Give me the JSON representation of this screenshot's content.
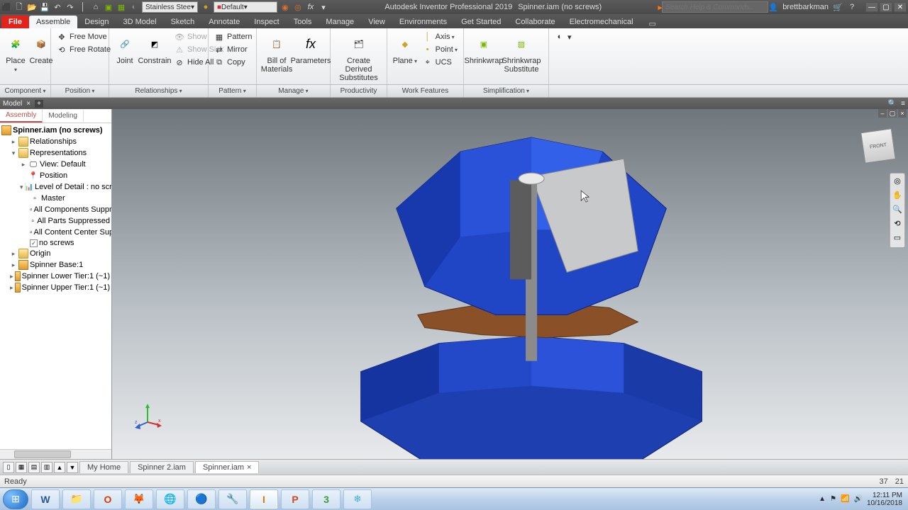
{
  "title": {
    "app": "Autodesk Inventor Professional 2019",
    "doc": "Spinner.iam (no screws)"
  },
  "search_placeholder": "Search Help & Commands..",
  "user": "brettbarkman",
  "material": "Stainless Stee",
  "appearance": "Default",
  "ribbon_tabs": [
    "File",
    "Assemble",
    "Design",
    "3D Model",
    "Sketch",
    "Annotate",
    "Inspect",
    "Tools",
    "Manage",
    "View",
    "Environments",
    "Get Started",
    "Collaborate",
    "Electromechanical"
  ],
  "ribbon": {
    "place": "Place",
    "create": "Create",
    "free_move": "Free Move",
    "free_rotate": "Free Rotate",
    "joint": "Joint",
    "constrain": "Constrain",
    "show": "Show",
    "show_sick": "Show Sick",
    "hide_all": "Hide All",
    "pattern": "Pattern",
    "mirror": "Mirror",
    "copy": "Copy",
    "bom": "Bill of Materials",
    "params": "Parameters",
    "derived": "Create Derived Substitutes",
    "plane": "Plane",
    "axis": "Axis",
    "point": "Point",
    "ucs": "UCS",
    "shrink": "Shrinkwrap",
    "shrinksub": "Shrinkwrap Substitute"
  },
  "panels": [
    "Component",
    "Position",
    "Relationships",
    "Pattern",
    "Manage",
    "Productivity",
    "Work Features",
    "Simplification"
  ],
  "browser": {
    "header": "Model",
    "tabs": [
      "Assembly",
      "Modeling"
    ],
    "root": "Spinner.iam (no screws)",
    "relationships": "Relationships",
    "representations": "Representations",
    "view_default": "View: Default",
    "position": "Position",
    "lod": "Level of Detail : no screws",
    "master": "Master",
    "all_comp": "All Components Suppressed",
    "all_parts": "All Parts Suppressed",
    "all_cc": "All Content Center Suppressed",
    "no_screws": "no screws",
    "origin": "Origin",
    "base": "Spinner Base:1",
    "lower": "Spinner Lower Tier:1 (~1)",
    "upper": "Spinner Upper Tier:1 (~1)"
  },
  "doc_tabs": {
    "home": "My Home",
    "t1": "Spinner 2.iam",
    "t2": "Spinner.iam"
  },
  "status": {
    "ready": "Ready",
    "n1": "37",
    "n2": "21"
  },
  "clock": {
    "time": "12:11 PM",
    "date": "10/16/2018"
  }
}
